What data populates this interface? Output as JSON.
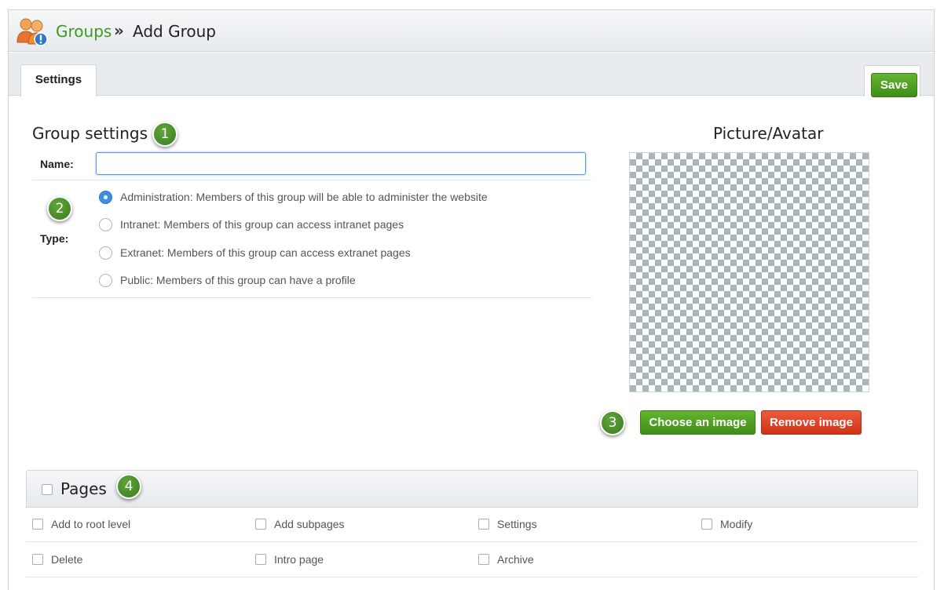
{
  "breadcrumb": {
    "parent": "Groups",
    "separator": "»",
    "current": "Add Group"
  },
  "tabs": [
    {
      "label": "Settings",
      "active": true
    }
  ],
  "toolbar": {
    "save_label": "Save"
  },
  "settings": {
    "title": "Group settings",
    "name_label": "Name:",
    "name_value": "",
    "type_label": "Type:",
    "type_options": [
      {
        "label": "Administration: Members of this group will be able to administer the website",
        "selected": true
      },
      {
        "label": "Intranet: Members of this group can access intranet pages",
        "selected": false
      },
      {
        "label": "Extranet: Members of this group can access extranet pages",
        "selected": false
      },
      {
        "label": "Public: Members of this group can have a profile",
        "selected": false
      }
    ]
  },
  "picture": {
    "title": "Picture/Avatar",
    "choose_label": "Choose an image",
    "remove_label": "Remove image"
  },
  "pages": {
    "title": "Pages",
    "checked": false,
    "permissions": [
      {
        "label": "Add to root level",
        "checked": false
      },
      {
        "label": "Add subpages",
        "checked": false
      },
      {
        "label": "Settings",
        "checked": false
      },
      {
        "label": "Modify",
        "checked": false
      },
      {
        "label": "Delete",
        "checked": false
      },
      {
        "label": "Intro page",
        "checked": false
      },
      {
        "label": "Archive",
        "checked": false
      }
    ]
  },
  "annotations": [
    "1",
    "2",
    "3",
    "4"
  ],
  "colors": {
    "accent_green": "#3d9a1f",
    "button_green": "#4f9f22",
    "button_red": "#d9391d",
    "radio_blue": "#3d8ede"
  },
  "icons": {
    "header_logo": "group-users-icon"
  }
}
